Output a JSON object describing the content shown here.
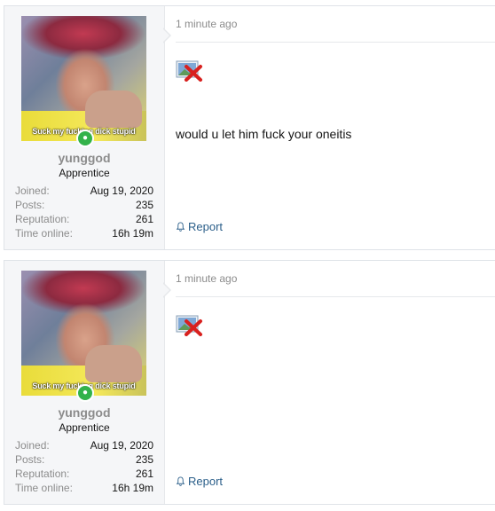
{
  "posts": [
    {
      "time": "1 minute ago",
      "avatar_caption": "Suck my fucking dick stupid",
      "username": "yunggod",
      "usertitle": "Apprentice",
      "stats": [
        {
          "label": "Joined:",
          "value": "Aug 19, 2020"
        },
        {
          "label": "Posts:",
          "value": "235"
        },
        {
          "label": "Reputation:",
          "value": "261"
        },
        {
          "label": "Time online:",
          "value": "16h 19m"
        }
      ],
      "message": "would u let him fuck your oneitis",
      "report_label": "Report",
      "online_icon": "user-online-icon",
      "image_icon": "broken-image-icon",
      "report_icon": "bell-icon"
    },
    {
      "time": "1 minute ago",
      "avatar_caption": "Suck my fucking dick stupid",
      "username": "yunggod",
      "usertitle": "Apprentice",
      "stats": [
        {
          "label": "Joined:",
          "value": "Aug 19, 2020"
        },
        {
          "label": "Posts:",
          "value": "235"
        },
        {
          "label": "Reputation:",
          "value": "261"
        },
        {
          "label": "Time online:",
          "value": "16h 19m"
        }
      ],
      "message": "",
      "report_label": "Report",
      "online_icon": "user-online-icon",
      "image_icon": "broken-image-icon",
      "report_icon": "bell-icon"
    }
  ],
  "colors": {
    "link": "#2b5f8a",
    "muted": "#8c8c8c",
    "online": "#33b24a",
    "sidebar_bg": "#f5f6f8"
  }
}
